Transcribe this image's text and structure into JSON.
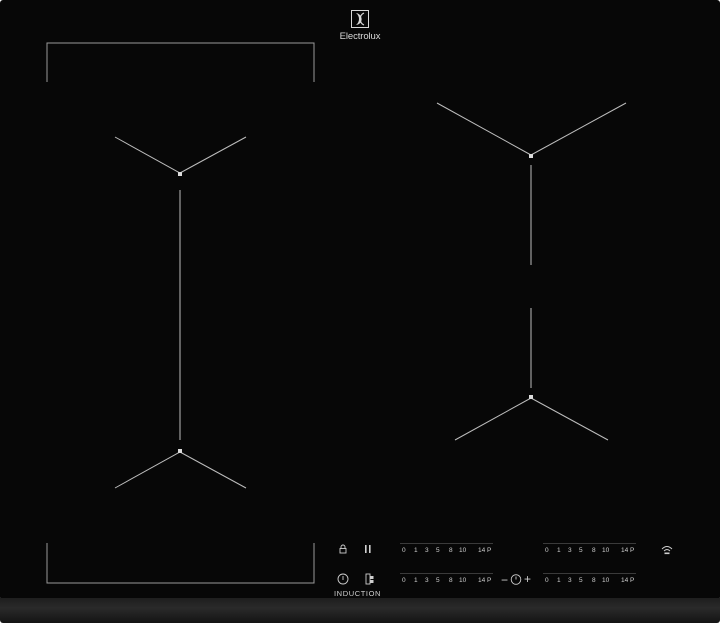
{
  "brand": {
    "name": "Electrolux",
    "icon": "electrolux-logo-icon"
  },
  "controls": {
    "scale_ticks": [
      "0",
      "1",
      "3",
      "5",
      "8",
      "10",
      "14",
      "P"
    ],
    "lock_icon": "lock-icon",
    "pause_icon": "pause-icon",
    "power_icon": "power-icon",
    "bridge_icon": "bridge-icon",
    "timer_minus": "−",
    "timer_plus": "+",
    "timer_icon": "timer-icon",
    "hob2hood_icon": "wifi-icon",
    "induction_label": "INDUCTION"
  },
  "colors": {
    "surface": "#070707",
    "markings": "#bdbdbd"
  }
}
